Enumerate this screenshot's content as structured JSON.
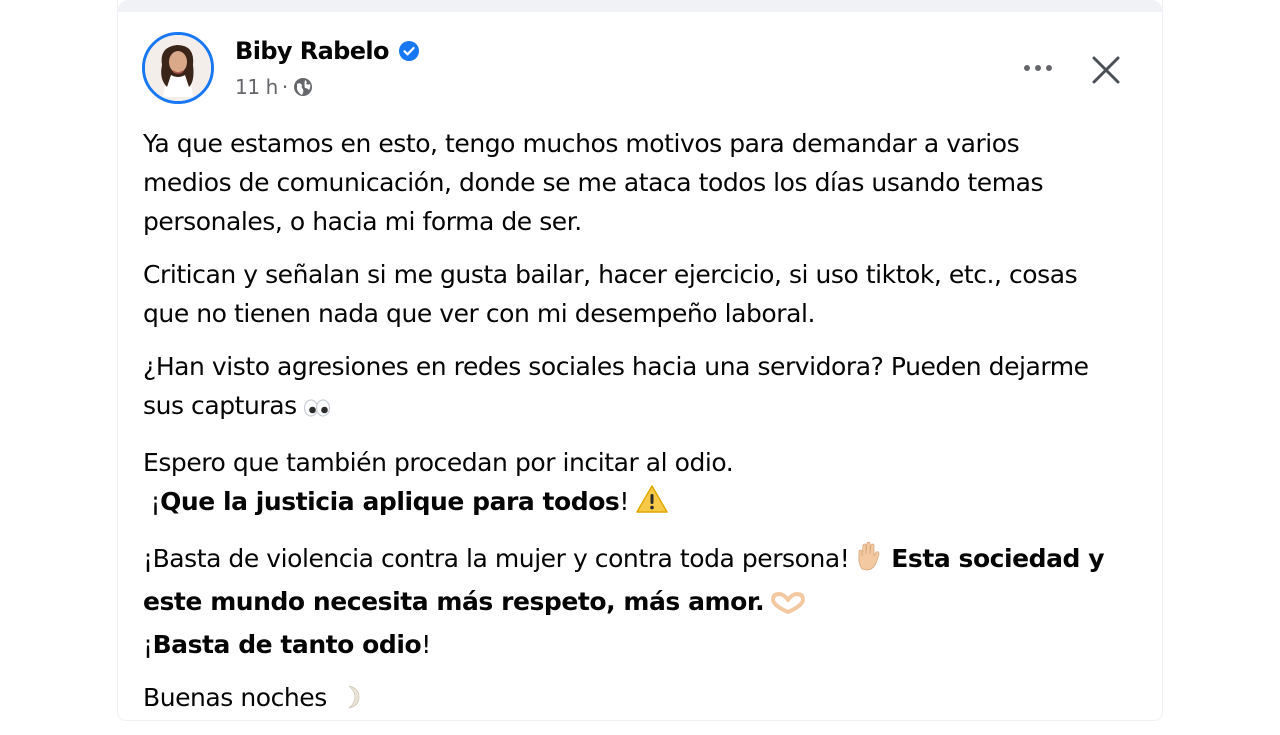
{
  "post": {
    "author": "Biby Rabelo",
    "time": "11 h",
    "separator": "·",
    "icons": {
      "verified": "verified-badge-icon",
      "privacy": "globe-icon",
      "more": "more-options-icon",
      "close": "close-icon"
    },
    "colors": {
      "verified": "#1877f2",
      "text": "#050505",
      "secondary": "#65676b"
    }
  },
  "content": {
    "p1": {
      "l1": "Ya que estamos en esto, tengo muchos motivos para demandar a varios",
      "l2": "medios de comunicación, donde se me ataca todos los días usando temas",
      "l3": "personales, o hacia mi forma de ser."
    },
    "p2": {
      "l1": "Critican y señalan si me gusta bailar, hacer ejercicio, si uso tiktok, etc., cosas",
      "l2": "que no tienen nada que ver con mi desempeño laboral."
    },
    "p3": {
      "l1": "¿Han visto agresiones en redes sociales hacia una servidora? Pueden dejarme",
      "l2": "sus capturas",
      "emoji": "eyes-emoji"
    },
    "p4": {
      "l1": "Espero que también procedan por incitar al odio.",
      "l2_pre": " ¡",
      "l2_bold": "Que la justicia aplique para todos",
      "l2_post": "!",
      "emoji": "warning-emoji"
    },
    "p5": {
      "l1_plain": "¡Basta de violencia contra la mujer y contra toda persona!",
      "l1_emoji": "raised-hand-emoji",
      "l1_bold": "Esta sociedad y",
      "l2_bold": "este mundo necesita más respeto, más amor.",
      "l2_emoji": "heart-hands-emoji",
      "l3_pre": "¡",
      "l3_bold": "Basta de tanto odio",
      "l3_post": "!"
    },
    "p6": {
      "l1": "Buenas noches",
      "emoji": "crescent-moon-emoji"
    }
  }
}
